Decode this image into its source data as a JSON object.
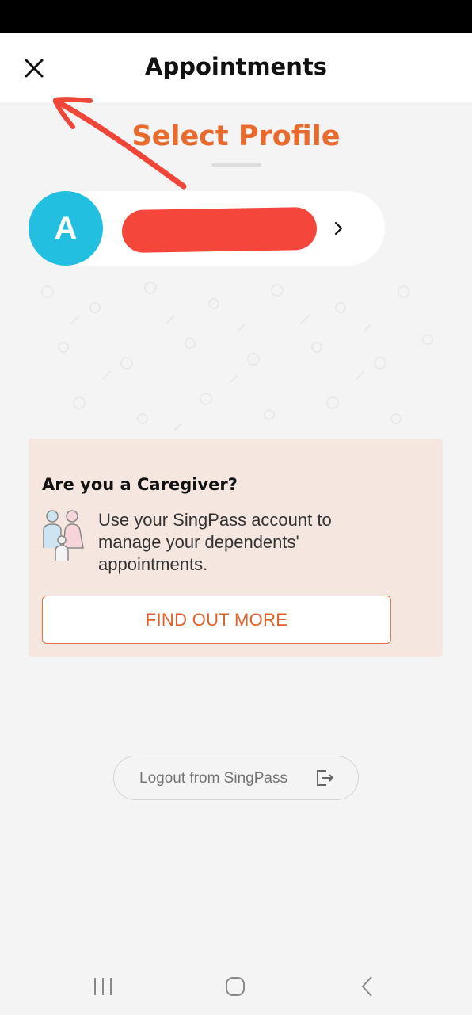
{
  "header": {
    "title": "Appointments",
    "close_icon": "close-icon"
  },
  "profile_section": {
    "title": "Select Profile",
    "profile": {
      "avatar_letter": "A",
      "avatar_color": "#22bfe0",
      "chevron_icon": "chevron-right-icon"
    }
  },
  "caregiver": {
    "title": "Are you a Caregiver?",
    "icon": "family-icon",
    "description": "Use your SingPass account to\nmanage your dependents'\nappointments.",
    "button_label": "FIND OUT MORE"
  },
  "logout": {
    "label": "Logout from SingPass",
    "icon": "logout-icon"
  },
  "nav_bar": {
    "recents_icon": "recents-icon",
    "home_icon": "home-icon",
    "back_icon": "back-icon"
  },
  "colors": {
    "accent": "#e86a2d",
    "caregiver_bg": "#f5e6e0",
    "page_bg": "#f4f4f4"
  }
}
